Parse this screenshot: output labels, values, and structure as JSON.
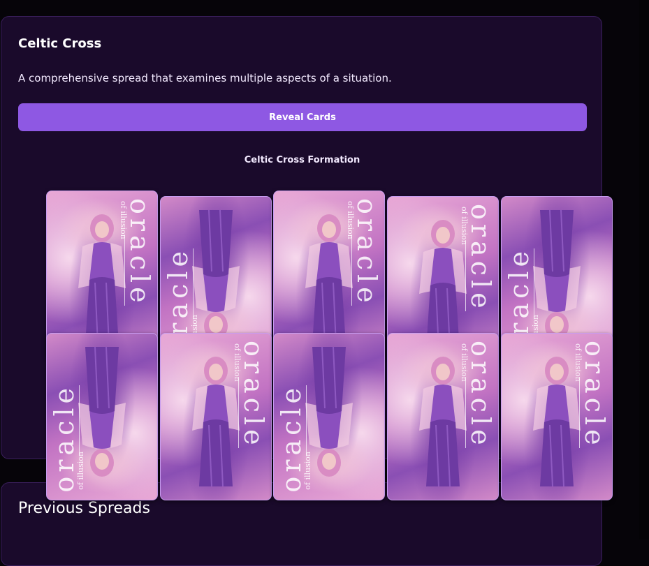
{
  "spread": {
    "title": "Celtic Cross",
    "description": "A comprehensive spread that examines multiple aspects of a situation.",
    "reveal_label": "Reveal Cards",
    "formation_label": "Celtic Cross Formation"
  },
  "cards": [
    {
      "mark": "oracle",
      "sub": "of illusion",
      "orientation": "upright"
    },
    {
      "mark": "oracle",
      "sub": "of illusion",
      "orientation": "reversed"
    },
    {
      "mark": "oracle",
      "sub": "of illusion",
      "orientation": "upright"
    },
    {
      "mark": "oracle",
      "sub": "of illusion",
      "orientation": "upright"
    },
    {
      "mark": "oracle",
      "sub": "of illusion",
      "orientation": "reversed"
    },
    {
      "mark": "oracle",
      "sub": "of illusion",
      "orientation": "reversed"
    },
    {
      "mark": "oracle",
      "sub": "of illusion",
      "orientation": "upright"
    },
    {
      "mark": "oracle",
      "sub": "of illusion",
      "orientation": "reversed"
    },
    {
      "mark": "oracle",
      "sub": "of illusion",
      "orientation": "upright"
    },
    {
      "mark": "oracle",
      "sub": "of illusion",
      "orientation": "upright"
    }
  ],
  "previous": {
    "title": "Previous Spreads"
  },
  "colors": {
    "panel_bg": "#1a0a2b",
    "accent": "#8e58e3",
    "page_bg": "#060409"
  }
}
